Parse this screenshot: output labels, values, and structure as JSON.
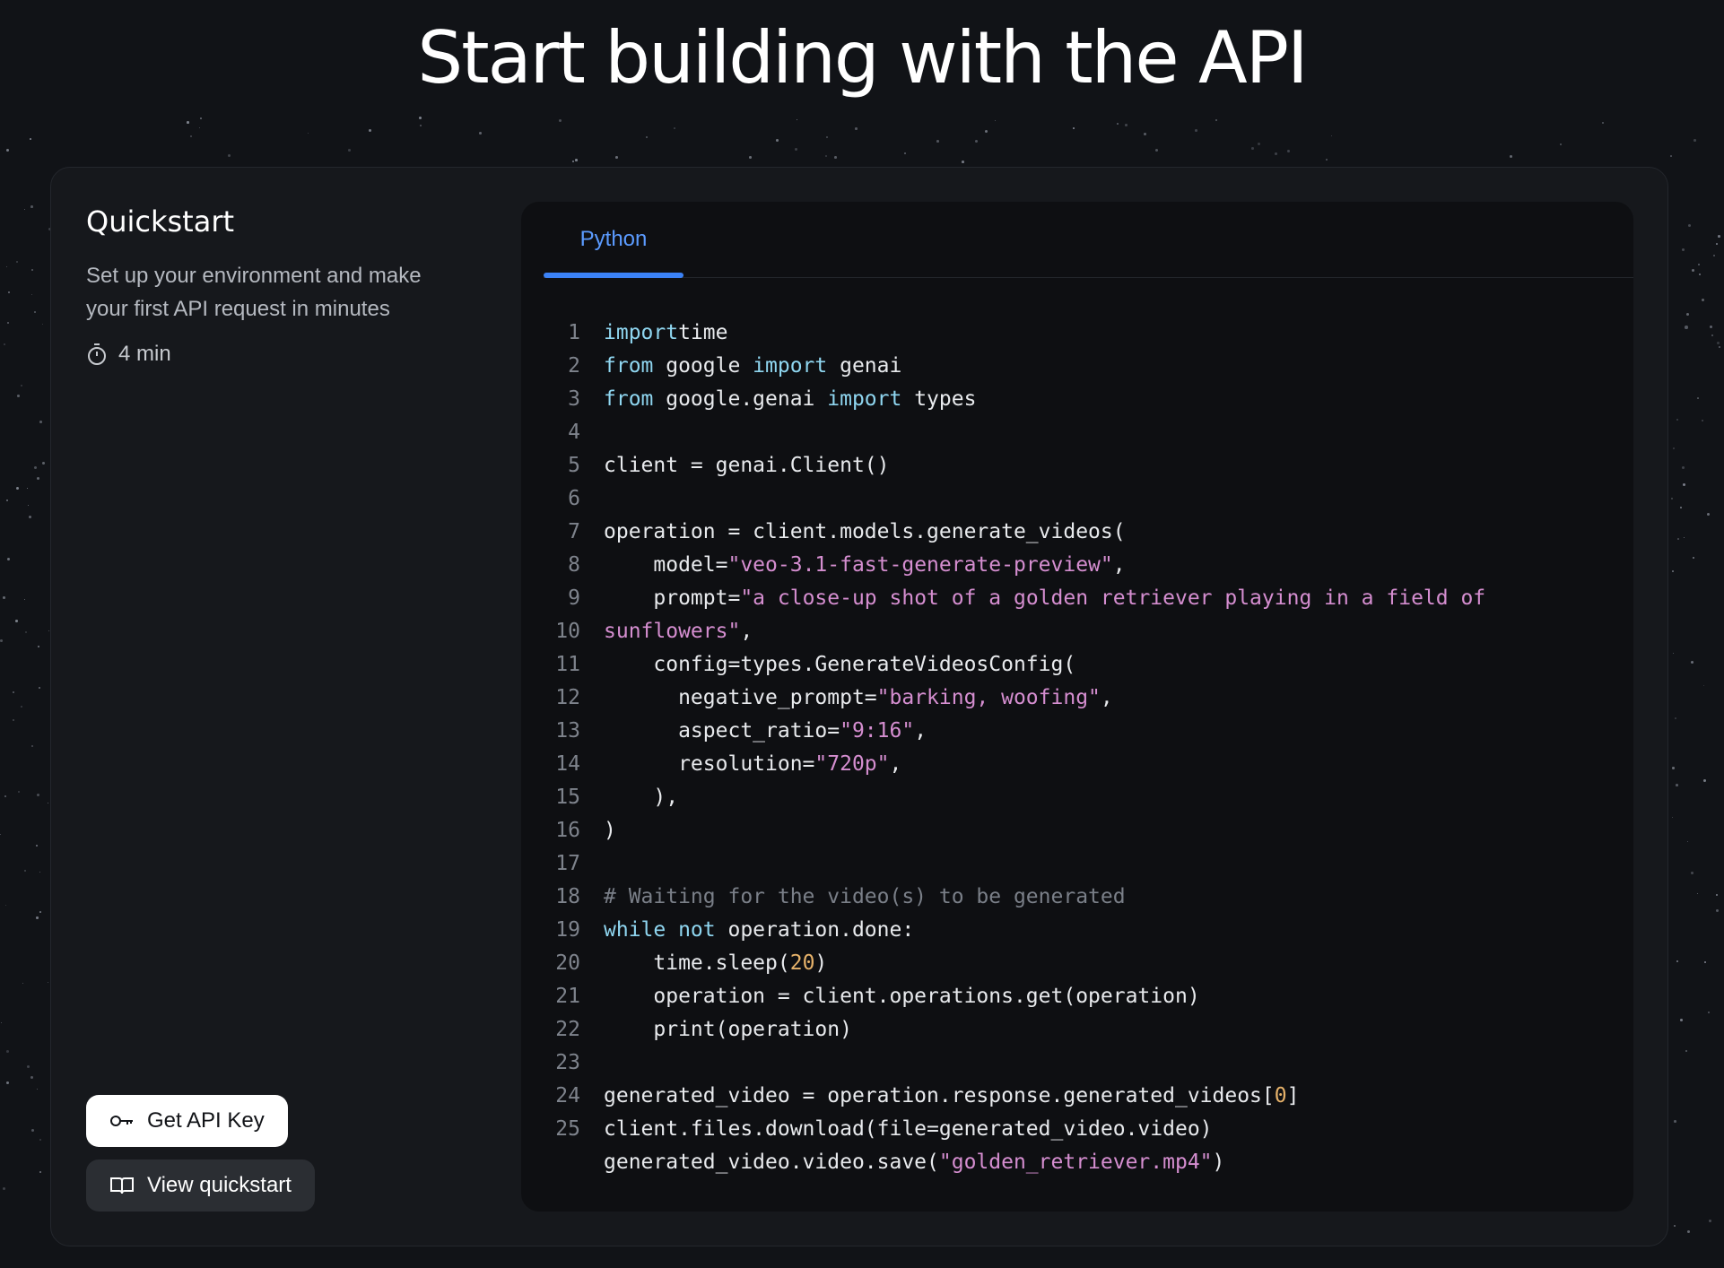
{
  "hero": {
    "title": "Start building with the API"
  },
  "quickstart": {
    "title": "Quickstart",
    "description": "Set up your environment and make your first API request in minutes",
    "time_icon": "stopwatch-icon",
    "duration": "4 min",
    "primary_button": {
      "label": "Get API Key",
      "icon": "key-icon"
    },
    "secondary_button": {
      "label": "View quickstart",
      "icon": "book-icon"
    }
  },
  "code": {
    "tabs": [
      {
        "label": "Python",
        "active": true
      }
    ],
    "lines": [
      {
        "n": "1",
        "tokens": [
          [
            "kw",
            "import"
          ],
          [
            "",
            "time"
          ]
        ]
      },
      {
        "n": "2",
        "tokens": [
          [
            "kw",
            "from"
          ],
          [
            "",
            " google "
          ],
          [
            "kw",
            "import"
          ],
          [
            "",
            " genai"
          ]
        ]
      },
      {
        "n": "3",
        "tokens": [
          [
            "kw",
            "from"
          ],
          [
            "",
            " google.genai "
          ],
          [
            "kw",
            "import"
          ],
          [
            "",
            " types"
          ]
        ]
      },
      {
        "n": "4",
        "tokens": []
      },
      {
        "n": "5",
        "tokens": [
          [
            "",
            "client = genai.Client()"
          ]
        ]
      },
      {
        "n": "6",
        "tokens": []
      },
      {
        "n": "7",
        "tokens": [
          [
            "",
            "operation = client.models.generate_videos("
          ]
        ]
      },
      {
        "n": "8",
        "tokens": [
          [
            "",
            "    model="
          ],
          [
            "str",
            "\"veo-3.1-fast-generate-preview\""
          ],
          [
            "",
            ","
          ]
        ]
      },
      {
        "n": "9",
        "tokens": [
          [
            "",
            "    prompt="
          ],
          [
            "str",
            "\"a close-up shot of a golden retriever playing in a field of"
          ]
        ]
      },
      {
        "n": "10",
        "tokens": [
          [
            "str",
            "sunflowers\""
          ],
          [
            "",
            ","
          ]
        ]
      },
      {
        "n": "11",
        "tokens": [
          [
            "",
            "    config=types.GenerateVideosConfig("
          ]
        ]
      },
      {
        "n": "12",
        "tokens": [
          [
            "",
            "      negative_prompt="
          ],
          [
            "str",
            "\"barking, woofing\""
          ],
          [
            "",
            ","
          ]
        ]
      },
      {
        "n": "13",
        "tokens": [
          [
            "",
            "      aspect_ratio="
          ],
          [
            "str",
            "\"9:16\""
          ],
          [
            "",
            ","
          ]
        ]
      },
      {
        "n": "14",
        "tokens": [
          [
            "",
            "      resolution="
          ],
          [
            "str",
            "\"720p\""
          ],
          [
            "",
            ","
          ]
        ]
      },
      {
        "n": "15",
        "tokens": [
          [
            "",
            "    ),"
          ]
        ]
      },
      {
        "n": "16",
        "tokens": [
          [
            "",
            ")"
          ]
        ]
      },
      {
        "n": "17",
        "tokens": []
      },
      {
        "n": "18",
        "tokens": [
          [
            "com",
            "# Waiting for the video(s) to be generated"
          ]
        ]
      },
      {
        "n": "19",
        "tokens": [
          [
            "kw",
            "while not"
          ],
          [
            "",
            " operation.done:"
          ]
        ]
      },
      {
        "n": "20",
        "tokens": [
          [
            "",
            "    time.sleep("
          ],
          [
            "num",
            "20"
          ],
          [
            "",
            ")"
          ]
        ]
      },
      {
        "n": "21",
        "tokens": [
          [
            "",
            "    operation = client.operations.get(operation)"
          ]
        ]
      },
      {
        "n": "22",
        "tokens": [
          [
            "",
            "    print(operation)"
          ]
        ]
      },
      {
        "n": "23",
        "tokens": []
      },
      {
        "n": "24",
        "tokens": [
          [
            "",
            "generated_video = operation.response.generated_videos["
          ],
          [
            "num",
            "0"
          ],
          [
            "",
            "]"
          ]
        ]
      },
      {
        "n": "25",
        "tokens": [
          [
            "",
            "client.files.download(file=generated_video.video)"
          ]
        ]
      },
      {
        "n": "",
        "tokens": [
          [
            "",
            "generated_video.video.save("
          ],
          [
            "str",
            "\"golden_retriever.mp4\""
          ],
          [
            "",
            ")"
          ]
        ]
      }
    ]
  }
}
